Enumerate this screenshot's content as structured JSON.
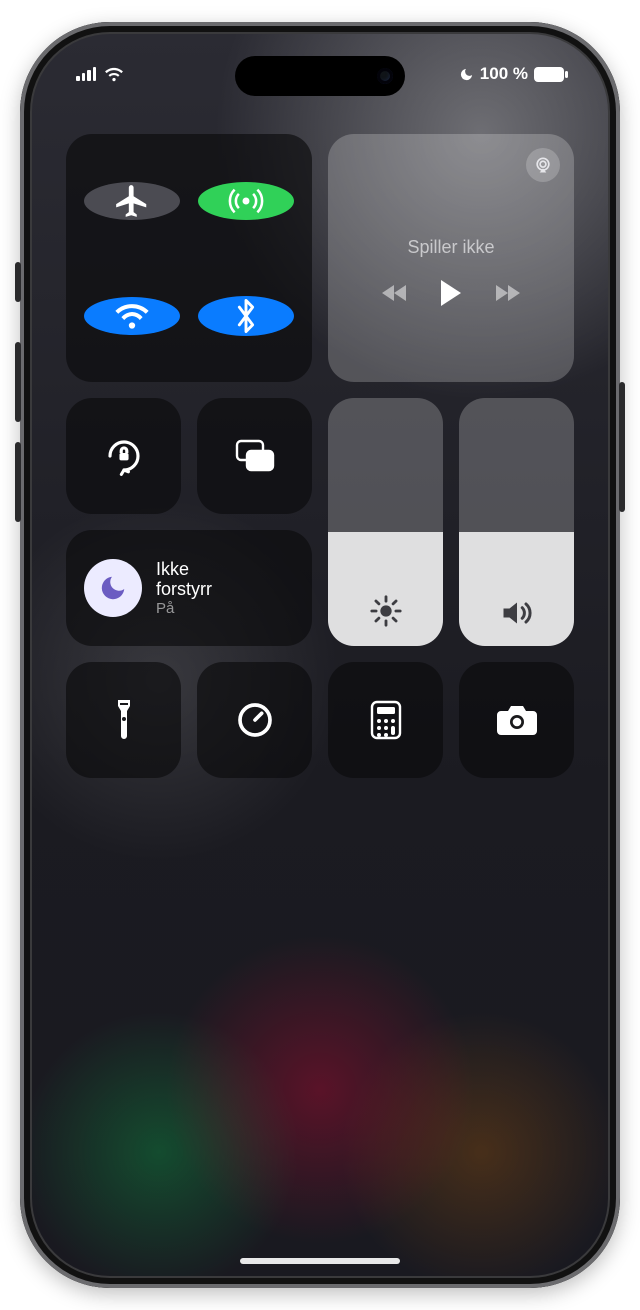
{
  "status": {
    "battery_text": "100 %",
    "dnd_active": true
  },
  "connectivity": {
    "airplane": {
      "active": false
    },
    "cellular": {
      "active": true
    },
    "wifi": {
      "active": true
    },
    "bluetooth": {
      "active": true
    }
  },
  "media": {
    "title": "Spiller ikke"
  },
  "focus": {
    "title_line1": "Ikke",
    "title_line2": "forstyrr",
    "state": "På"
  },
  "brightness": {
    "level_pct": 46
  },
  "volume": {
    "level_pct": 46
  },
  "shortcuts": {
    "flashlight": "flashlight",
    "timer": "timer",
    "calculator": "calculator",
    "camera": "camera"
  },
  "colors": {
    "active_blue": "#0a7cff",
    "active_green": "#30d158"
  }
}
